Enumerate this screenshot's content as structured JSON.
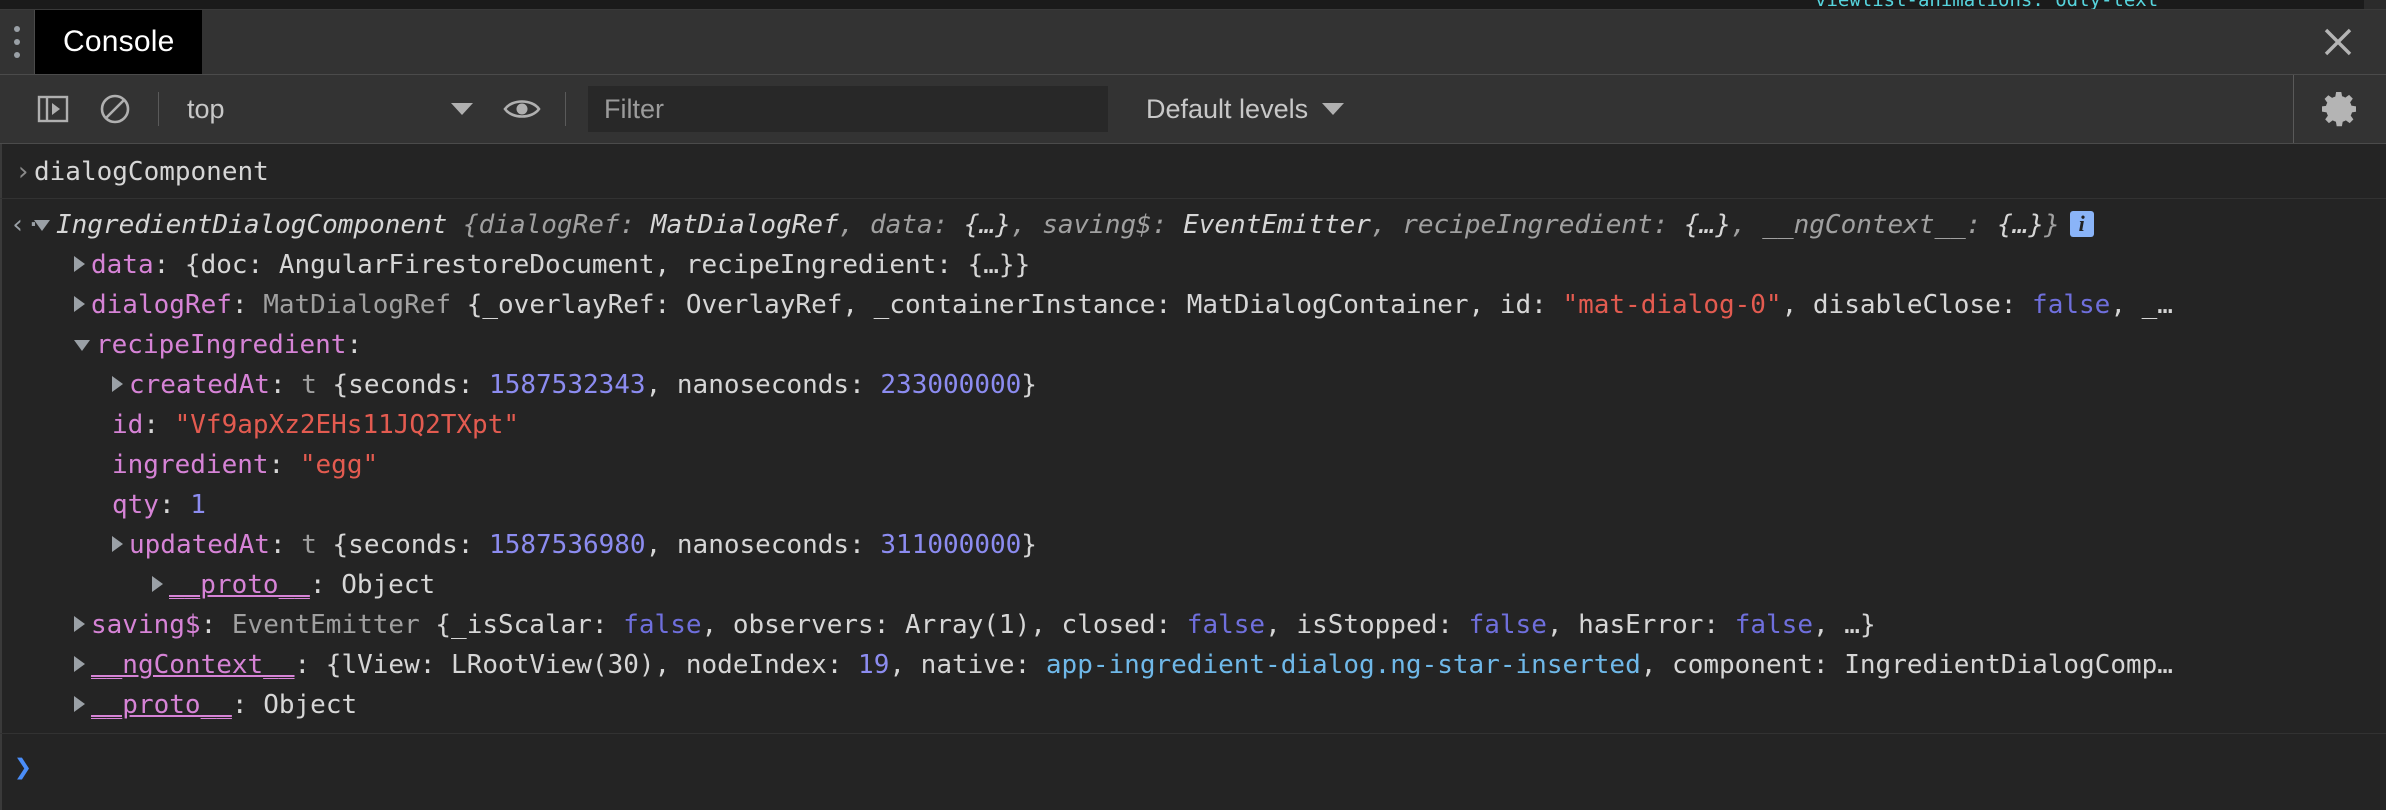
{
  "page_sliver": {
    "text": "viewlist-animations: odly-text"
  },
  "tabstrip": {
    "menu_icon": "kebab-menu-icon",
    "tabs": [
      {
        "label": "Console",
        "active": true
      }
    ],
    "close_label": "close-icon"
  },
  "toolbar": {
    "sidebar_toggle_icon": "show-console-sidebar-icon",
    "clear_icon": "clear-console-icon",
    "context_selector": {
      "value": "top",
      "caret": "chevron-down-icon"
    },
    "eye_icon": "create-live-expression-icon",
    "filter": {
      "value": "",
      "placeholder": "Filter"
    },
    "levels": {
      "label": "Default levels",
      "caret": "chevron-down-icon"
    },
    "settings_icon": "gear-icon"
  },
  "console": {
    "input_line": {
      "gutter": "›",
      "text": "dialogComponent"
    },
    "output": {
      "gutter": "‹·",
      "header": {
        "name": "IngredientDialogComponent",
        "preview_open": " {",
        "parts": [
          {
            "key": "dialogRef",
            "sep": ": ",
            "val": "MatDialogRef",
            "type": "plain",
            "tail": ", "
          },
          {
            "key": "data",
            "sep": ": ",
            "val": "{…}",
            "type": "plain",
            "tail": ", "
          },
          {
            "key": "saving$",
            "sep": ": ",
            "val": "EventEmitter",
            "type": "plain",
            "tail": ", "
          },
          {
            "key": "recipeIngredient",
            "sep": ": ",
            "val": "{…}",
            "type": "plain",
            "tail": ", "
          },
          {
            "key": "__ngContext__",
            "sep": ": ",
            "val": "{…}",
            "type": "plain",
            "tail": ""
          }
        ],
        "preview_close": "}",
        "badge": "i"
      },
      "rows": [
        {
          "id": "data",
          "indent": 1,
          "arrow": "collapsed",
          "prop": "data",
          "segments": [
            {
              "t": ": {doc: ",
              "c": "plain"
            },
            {
              "t": "AngularFirestoreDocument",
              "c": "plain"
            },
            {
              "t": ", recipeIngredient: ",
              "c": "plain"
            },
            {
              "t": "{…}}",
              "c": "plain"
            }
          ]
        },
        {
          "id": "dialogRef",
          "indent": 1,
          "arrow": "collapsed",
          "prop": "dialogRef",
          "segments": [
            {
              "t": ": ",
              "c": "plain"
            },
            {
              "t": "MatDialogRef",
              "c": "dim"
            },
            {
              "t": " {_overlayRef: OverlayRef, _containerInstance: MatDialogContainer, id: ",
              "c": "plain"
            },
            {
              "t": "\"mat-dialog-0\"",
              "c": "str"
            },
            {
              "t": ", disableClose: ",
              "c": "plain"
            },
            {
              "t": "false",
              "c": "bool"
            },
            {
              "t": ", _…",
              "c": "plain"
            }
          ]
        },
        {
          "id": "recipeIngredient",
          "indent": 1,
          "arrow": "expanded",
          "prop": "recipeIngredient",
          "segments": [
            {
              "t": ":",
              "c": "plain"
            }
          ]
        },
        {
          "id": "createdAt",
          "indent": 2,
          "arrow": "collapsed",
          "prop": "createdAt",
          "segments": [
            {
              "t": ": ",
              "c": "plain"
            },
            {
              "t": "t",
              "c": "dim"
            },
            {
              "t": " {seconds: ",
              "c": "plain"
            },
            {
              "t": "1587532343",
              "c": "num"
            },
            {
              "t": ", nanoseconds: ",
              "c": "plain"
            },
            {
              "t": "233000000",
              "c": "num"
            },
            {
              "t": "}",
              "c": "plain"
            }
          ]
        },
        {
          "id": "id",
          "indent": 2,
          "arrow": "none",
          "prop": "id",
          "segments": [
            {
              "t": ": ",
              "c": "plain"
            },
            {
              "t": "\"Vf9apXz2EHs11JQ2TXpt\"",
              "c": "str"
            }
          ]
        },
        {
          "id": "ingredient",
          "indent": 2,
          "arrow": "none",
          "prop": "ingredient",
          "segments": [
            {
              "t": ": ",
              "c": "plain"
            },
            {
              "t": "\"egg\"",
              "c": "str"
            }
          ]
        },
        {
          "id": "qty",
          "indent": 2,
          "arrow": "none",
          "prop": "qty",
          "segments": [
            {
              "t": ": ",
              "c": "plain"
            },
            {
              "t": "1",
              "c": "num"
            }
          ]
        },
        {
          "id": "updatedAt",
          "indent": 2,
          "arrow": "collapsed",
          "prop": "updatedAt",
          "segments": [
            {
              "t": ": ",
              "c": "plain"
            },
            {
              "t": "t",
              "c": "dim"
            },
            {
              "t": " {seconds: ",
              "c": "plain"
            },
            {
              "t": "1587536980",
              "c": "num"
            },
            {
              "t": ", nanoseconds: ",
              "c": "plain"
            },
            {
              "t": "311000000",
              "c": "num"
            },
            {
              "t": "}",
              "c": "plain"
            }
          ]
        },
        {
          "id": "proto-inner",
          "indent": 3,
          "arrow": "collapsed",
          "prop": "__proto__",
          "prop_underline": true,
          "segments": [
            {
              "t": ": ",
              "c": "plain"
            },
            {
              "t": "Object",
              "c": "plain"
            }
          ]
        },
        {
          "id": "saving$",
          "indent": 1,
          "arrow": "collapsed",
          "prop": "saving$",
          "segments": [
            {
              "t": ": ",
              "c": "plain"
            },
            {
              "t": "EventEmitter",
              "c": "dim"
            },
            {
              "t": " {_isScalar: ",
              "c": "plain"
            },
            {
              "t": "false",
              "c": "bool"
            },
            {
              "t": ", observers: ",
              "c": "plain"
            },
            {
              "t": "Array(1)",
              "c": "plain"
            },
            {
              "t": ", closed: ",
              "c": "plain"
            },
            {
              "t": "false",
              "c": "bool"
            },
            {
              "t": ", isStopped: ",
              "c": "plain"
            },
            {
              "t": "false",
              "c": "bool"
            },
            {
              "t": ", hasError: ",
              "c": "plain"
            },
            {
              "t": "false",
              "c": "bool"
            },
            {
              "t": ", …}",
              "c": "plain"
            }
          ]
        },
        {
          "id": "ngContext",
          "indent": 1,
          "arrow": "collapsed",
          "prop": "__ngContext__",
          "prop_underline": true,
          "segments": [
            {
              "t": ": {lView: ",
              "c": "plain"
            },
            {
              "t": "LRootView(30)",
              "c": "plain"
            },
            {
              "t": ", nodeIndex: ",
              "c": "plain"
            },
            {
              "t": "19",
              "c": "num"
            },
            {
              "t": ", native: ",
              "c": "plain"
            },
            {
              "t": "app-ingredient-dialog.ng-star-inserted",
              "c": "node"
            },
            {
              "t": ", component: ",
              "c": "plain"
            },
            {
              "t": "IngredientDialogComp…",
              "c": "plain"
            }
          ]
        },
        {
          "id": "proto-outer",
          "indent": 1,
          "arrow": "collapsed",
          "prop": "__proto__",
          "prop_underline": true,
          "segments": [
            {
              "t": ": ",
              "c": "plain"
            },
            {
              "t": "Object",
              "c": "plain"
            }
          ]
        }
      ]
    },
    "prompt": {
      "chevron": "❯"
    }
  }
}
